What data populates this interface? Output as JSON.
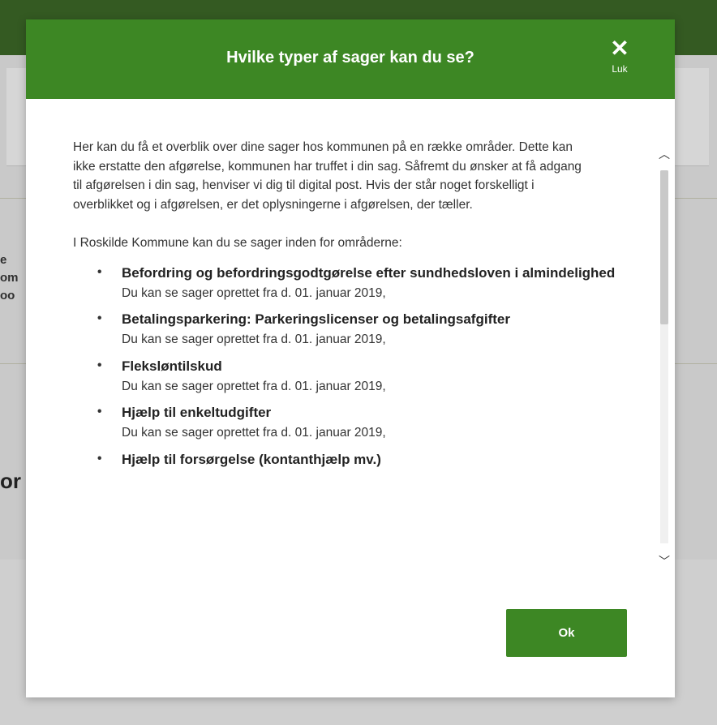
{
  "modal": {
    "title": "Hvilke typer af sager kan du se?",
    "close_label": "Luk",
    "intro": "Her kan du få et overblik over dine sager hos kommunen på en række områder. Dette kan ikke erstatte den afgørelse, kommunen har truffet i din sag. Såfremt du ønsker at få adgang til afgørelsen i din sag, henviser vi dig til digital post. Hvis der står noget forskelligt i overblikket og i afgørelsen, er det oplysningerne i afgørelsen, der tæller.",
    "areas_intro": "I Roskilde Kommune kan du se sager inden for områderne:",
    "areas": [
      {
        "title": "Befordring og befordringsgodtgørelse efter sundhedsloven i almindelighed",
        "note": "Du kan se sager oprettet fra d. 01. januar 2019,"
      },
      {
        "title": "Betalingsparkering: Parkeringslicenser og betalingsafgifter",
        "note": "Du kan se sager oprettet fra d. 01. januar 2019,"
      },
      {
        "title": "Fleksløntilskud",
        "note": "Du kan se sager oprettet fra d. 01. januar 2019,"
      },
      {
        "title": "Hjælp til enkeltudgifter",
        "note": "Du kan se sager oprettet fra d. 01. januar 2019,"
      },
      {
        "title": "Hjælp til forsørgelse (kontanthjælp mv.)",
        "note": ""
      }
    ],
    "ok_label": "Ok"
  },
  "background": {
    "fragments": [
      "e",
      "om",
      "oo"
    ],
    "heading_fragment": "or"
  },
  "colors": {
    "header_green": "#3d8724",
    "button_green": "#3d8724",
    "text": "#333333"
  },
  "icons": {
    "close": "close-icon",
    "scroll_up": "chevron-up-icon",
    "scroll_down": "chevron-down-icon"
  }
}
